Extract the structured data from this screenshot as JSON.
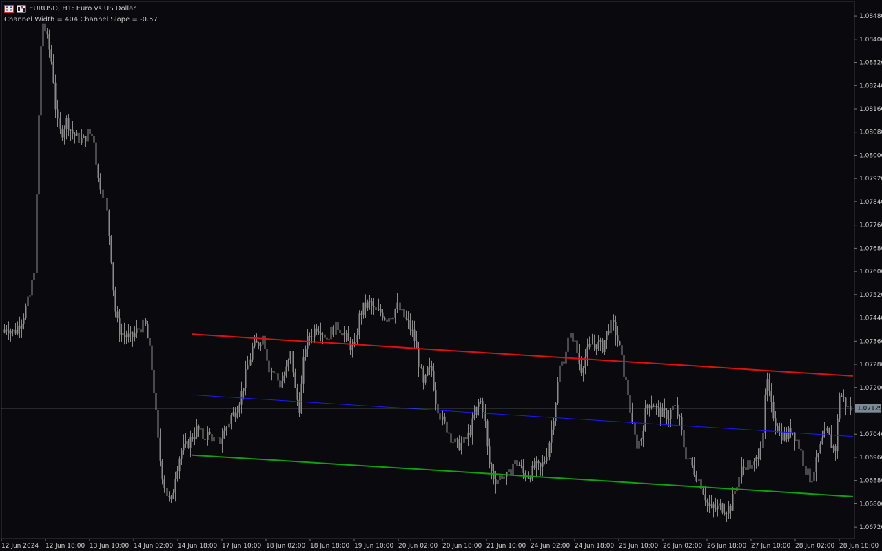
{
  "header": {
    "symbol_title": "EURUSD, H1:  Euro vs US Dollar",
    "channel_info": "Channel Width = 404 Channel Slope = -0.57"
  },
  "price_axis": {
    "labels": [
      "1.08480",
      "1.08400",
      "1.08320",
      "1.08240",
      "1.08160",
      "1.08080",
      "1.08000",
      "1.07920",
      "1.07840",
      "1.07760",
      "1.07680",
      "1.07600",
      "1.07520",
      "1.07440",
      "1.07360",
      "1.07280",
      "1.07200",
      "1.07040",
      "1.06960",
      "1.06880",
      "1.06800",
      "1.06720"
    ],
    "current_price": "1.07129"
  },
  "time_axis": {
    "labels": [
      "12 Jun 2024",
      "12 Jun 18:00",
      "13 Jun 10:00",
      "14 Jun 02:00",
      "14 Jun 18:00",
      "17 Jun 10:00",
      "18 Jun 02:00",
      "18 Jun 18:00",
      "19 Jun 10:00",
      "20 Jun 02:00",
      "20 Jun 18:00",
      "21 Jun 10:00",
      "24 Jun 02:00",
      "24 Jun 18:00",
      "25 Jun 10:00",
      "26 Jun 02:00",
      "26 Jun 18:00",
      "27 Jun 10:00",
      "28 Jun 02:00",
      "28 Jun 18:00"
    ]
  },
  "colors": {
    "background": "#0a0a0e",
    "candle": "#8a8a8a",
    "upper_line": "#e01010",
    "middle_line": "#1a1aff",
    "lower_line": "#10a010",
    "current_price_line": "#7a8a8a"
  },
  "channel": {
    "upper": [
      1.07384,
      1.0724
    ],
    "middle": [
      1.07175,
      1.07032
    ],
    "lower": [
      1.06968,
      1.06825
    ]
  },
  "chart_data": {
    "type": "candlestick",
    "symbol": "EURUSD",
    "timeframe": "H1",
    "y_range": [
      1.0668,
      1.0853
    ],
    "close_path": [
      [
        0,
        1.0737
      ],
      [
        8,
        1.0741
      ],
      [
        20,
        1.0739
      ],
      [
        32,
        1.0744
      ],
      [
        44,
        1.0752
      ],
      [
        50,
        1.0762
      ],
      [
        55,
        1.0808
      ],
      [
        58,
        1.0835
      ],
      [
        62,
        1.0846
      ],
      [
        66,
        1.0842
      ],
      [
        70,
        1.0838
      ],
      [
        76,
        1.083
      ],
      [
        82,
        1.0812
      ],
      [
        88,
        1.0807
      ],
      [
        96,
        1.0812
      ],
      [
        104,
        1.0808
      ],
      [
        112,
        1.0806
      ],
      [
        120,
        1.0805
      ],
      [
        128,
        1.0808
      ],
      [
        136,
        1.0806
      ],
      [
        142,
        1.0792
      ],
      [
        148,
        1.0788
      ],
      [
        154,
        1.0782
      ],
      [
        160,
        1.0768
      ],
      [
        166,
        1.0748
      ],
      [
        172,
        1.074
      ],
      [
        180,
        1.0738
      ],
      [
        190,
        1.0737
      ],
      [
        200,
        1.074
      ],
      [
        210,
        1.0742
      ],
      [
        218,
        1.0731
      ],
      [
        224,
        1.0717
      ],
      [
        230,
        1.0699
      ],
      [
        236,
        1.0689
      ],
      [
        242,
        1.0683
      ],
      [
        248,
        1.068
      ],
      [
        254,
        1.069
      ],
      [
        262,
        1.0698
      ],
      [
        270,
        1.07
      ],
      [
        278,
        1.0703
      ],
      [
        286,
        1.0706
      ],
      [
        294,
        1.0703
      ],
      [
        302,
        1.0704
      ],
      [
        310,
        1.0702
      ],
      [
        318,
        1.0701
      ],
      [
        326,
        1.0705
      ],
      [
        334,
        1.071
      ],
      [
        342,
        1.0712
      ],
      [
        350,
        1.0718
      ],
      [
        358,
        1.0726
      ],
      [
        366,
        1.0734
      ],
      [
        374,
        1.0735
      ],
      [
        382,
        1.0738
      ],
      [
        390,
        1.0727
      ],
      [
        398,
        1.0725
      ],
      [
        406,
        1.0721
      ],
      [
        414,
        1.0725
      ],
      [
        422,
        1.0732
      ],
      [
        428,
        1.0718
      ],
      [
        434,
        1.0713
      ],
      [
        442,
        1.0734
      ],
      [
        450,
        1.0738
      ],
      [
        458,
        1.0741
      ],
      [
        466,
        1.074
      ],
      [
        474,
        1.0737
      ],
      [
        482,
        1.074
      ],
      [
        490,
        1.0741
      ],
      [
        498,
        1.0739
      ],
      [
        506,
        1.0735
      ],
      [
        514,
        1.0733
      ],
      [
        520,
        1.0744
      ],
      [
        528,
        1.0748
      ],
      [
        536,
        1.0749
      ],
      [
        544,
        1.0746
      ],
      [
        552,
        1.0746
      ],
      [
        560,
        1.0744
      ],
      [
        568,
        1.0745
      ],
      [
        576,
        1.0748
      ],
      [
        584,
        1.0745
      ],
      [
        592,
        1.0742
      ],
      [
        600,
        1.0738
      ],
      [
        608,
        1.0728
      ],
      [
        614,
        1.072
      ],
      [
        620,
        1.0726
      ],
      [
        626,
        1.0726
      ],
      [
        632,
        1.0716
      ],
      [
        640,
        1.0709
      ],
      [
        648,
        1.0706
      ],
      [
        656,
        1.0702
      ],
      [
        664,
        1.07
      ],
      [
        672,
        1.0701
      ],
      [
        680,
        1.0704
      ],
      [
        688,
        1.071
      ],
      [
        696,
        1.0716
      ],
      [
        702,
        1.0712
      ],
      [
        708,
        1.0695
      ],
      [
        714,
        1.069
      ],
      [
        720,
        1.0688
      ],
      [
        728,
        1.069
      ],
      [
        736,
        1.0689
      ],
      [
        744,
        1.0694
      ],
      [
        752,
        1.0694
      ],
      [
        760,
        1.069
      ],
      [
        768,
        1.069
      ],
      [
        776,
        1.0693
      ],
      [
        784,
        1.0692
      ],
      [
        792,
        1.0696
      ],
      [
        800,
        1.0706
      ],
      [
        806,
        1.0716
      ],
      [
        812,
        1.0727
      ],
      [
        818,
        1.073
      ],
      [
        824,
        1.0736
      ],
      [
        830,
        1.0738
      ],
      [
        836,
        1.0733
      ],
      [
        842,
        1.0726
      ],
      [
        850,
        1.0731
      ],
      [
        858,
        1.0735
      ],
      [
        866,
        1.0735
      ],
      [
        874,
        1.0734
      ],
      [
        882,
        1.074
      ],
      [
        888,
        1.0742
      ],
      [
        894,
        1.0738
      ],
      [
        900,
        1.0732
      ],
      [
        906,
        1.0724
      ],
      [
        912,
        1.0717
      ],
      [
        918,
        1.0705
      ],
      [
        924,
        1.07
      ],
      [
        930,
        1.0703
      ],
      [
        938,
        1.0714
      ],
      [
        946,
        1.0715
      ],
      [
        954,
        1.0712
      ],
      [
        962,
        1.0711
      ],
      [
        970,
        1.071
      ],
      [
        978,
        1.0714
      ],
      [
        986,
        1.0708
      ],
      [
        994,
        1.0697
      ],
      [
        1000,
        1.0695
      ],
      [
        1008,
        1.0691
      ],
      [
        1016,
        1.0687
      ],
      [
        1022,
        1.0683
      ],
      [
        1028,
        1.0679
      ],
      [
        1036,
        1.0678
      ],
      [
        1044,
        1.0679
      ],
      [
        1052,
        1.0678
      ],
      [
        1060,
        1.0679
      ],
      [
        1068,
        1.0686
      ],
      [
        1076,
        1.0692
      ],
      [
        1084,
        1.0694
      ],
      [
        1092,
        1.0692
      ],
      [
        1100,
        1.0697
      ],
      [
        1106,
        1.0704
      ],
      [
        1112,
        1.0723
      ],
      [
        1118,
        1.0714
      ],
      [
        1124,
        1.0709
      ],
      [
        1132,
        1.0704
      ],
      [
        1140,
        1.0703
      ],
      [
        1148,
        1.0706
      ],
      [
        1156,
        1.0702
      ],
      [
        1162,
        1.0698
      ],
      [
        1168,
        1.0692
      ],
      [
        1176,
        1.0688
      ],
      [
        1184,
        1.0694
      ],
      [
        1192,
        1.0701
      ],
      [
        1200,
        1.0705
      ],
      [
        1206,
        1.07
      ],
      [
        1212,
        1.0699
      ],
      [
        1218,
        1.0718
      ],
      [
        1224,
        1.0716
      ],
      [
        1232,
        1.0712
      ],
      [
        1238,
        1.0714
      ]
    ]
  }
}
